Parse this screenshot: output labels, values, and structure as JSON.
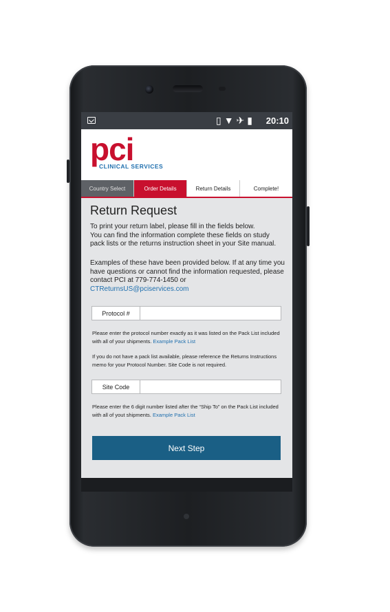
{
  "status_bar": {
    "time": "20:10",
    "icons": [
      "gmail-icon",
      "vibrate-icon",
      "wifi-icon",
      "airplane-icon",
      "battery-icon"
    ]
  },
  "header": {
    "logo": "pci",
    "logo_sub": "CLINICAL SERVICES"
  },
  "steps": [
    {
      "label": "Country Select"
    },
    {
      "label": "Order Details"
    },
    {
      "label": "Return Details"
    },
    {
      "label": "Complete!"
    }
  ],
  "page": {
    "title": "Return Request",
    "intro_1": "To print your return label, please fill in the fields below.",
    "intro_2": "You can find the information complete these fields on study pack lists or the returns instruction sheet in your Site manual.",
    "intro_3": "Examples of these have been provided below. If at any time you have questions or cannot find the information requested, please contact PCI at 779-774-1450 or",
    "email": "CTReturnsUS@pciservices.com"
  },
  "protocol": {
    "label": "Protocol #",
    "value": "",
    "note": "Please enter the protocol number exactly as it was listed on the Pack List included with all of your shipments.",
    "link": "Example Pack List",
    "note_2": "If you do not have a pack list available, please reference the Returns Instructions memo for your Protocol Number. Site Code is not required."
  },
  "site_code": {
    "label": "Site Code",
    "value": "",
    "note": "Please enter the 6 digit number listed after the “Ship To” on the Pack List included with all of yout shipments.",
    "link": "Example Pack List"
  },
  "next_button": "Next Step",
  "colors": {
    "brand_red": "#c8102e",
    "brand_blue": "#1f6fae",
    "button_blue": "#1a5f85"
  }
}
